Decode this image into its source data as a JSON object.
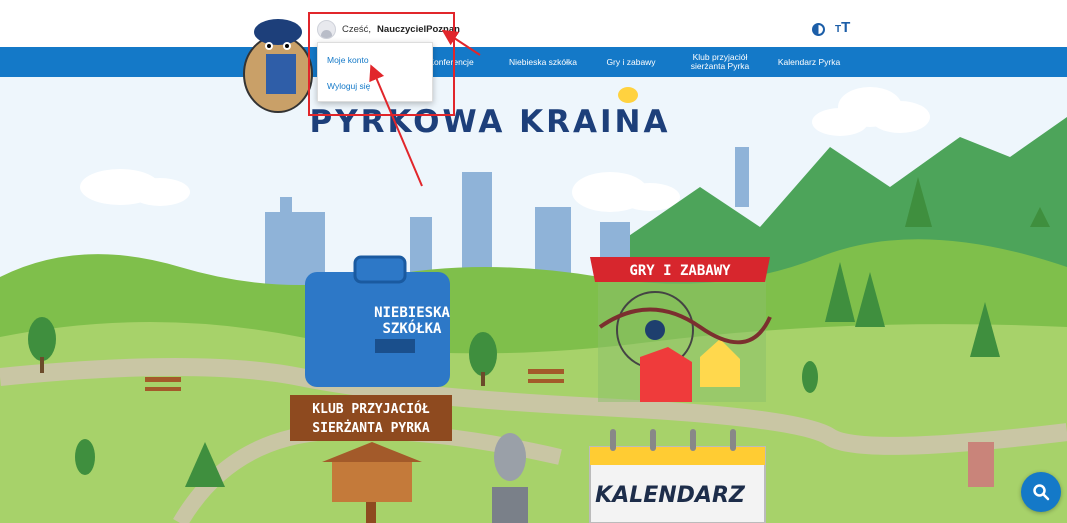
{
  "header": {
    "greeting_prefix": "Cześć,",
    "username": "NauczycielPoznan",
    "contrast_icon": "contrast-icon",
    "text_size_icon": "text-size-icon",
    "text_size_glyph": "T"
  },
  "nav": {
    "items": [
      {
        "label": "Konferencje"
      },
      {
        "label": "Niebieska szkółka"
      },
      {
        "label": "Gry i zabawy"
      },
      {
        "label": "Klub przyjaciół sierżanta Pyrka"
      },
      {
        "label": "Kalendarz Pyrka"
      }
    ]
  },
  "dropdown": {
    "items": [
      {
        "label": "Moje konto"
      },
      {
        "label": "Wyloguj się"
      }
    ]
  },
  "scene": {
    "title": "PYRKOWA KRAINA",
    "buildings": {
      "school": [
        "NIEBIESKA",
        "SZKÓŁKA"
      ],
      "games": "GRY I ZABAWY",
      "club": [
        "KLUB PRZYJACIÓŁ",
        "SIERŻANTA PYRKA"
      ],
      "calendar": "KALENDARZ"
    }
  },
  "search_icon": "search-icon",
  "colors": {
    "nav_bg": "#1479c8",
    "highlight": "#e1262b",
    "sky": "#eaf3fb",
    "grass": "#9ccd5a",
    "path": "#c9c6a4"
  }
}
